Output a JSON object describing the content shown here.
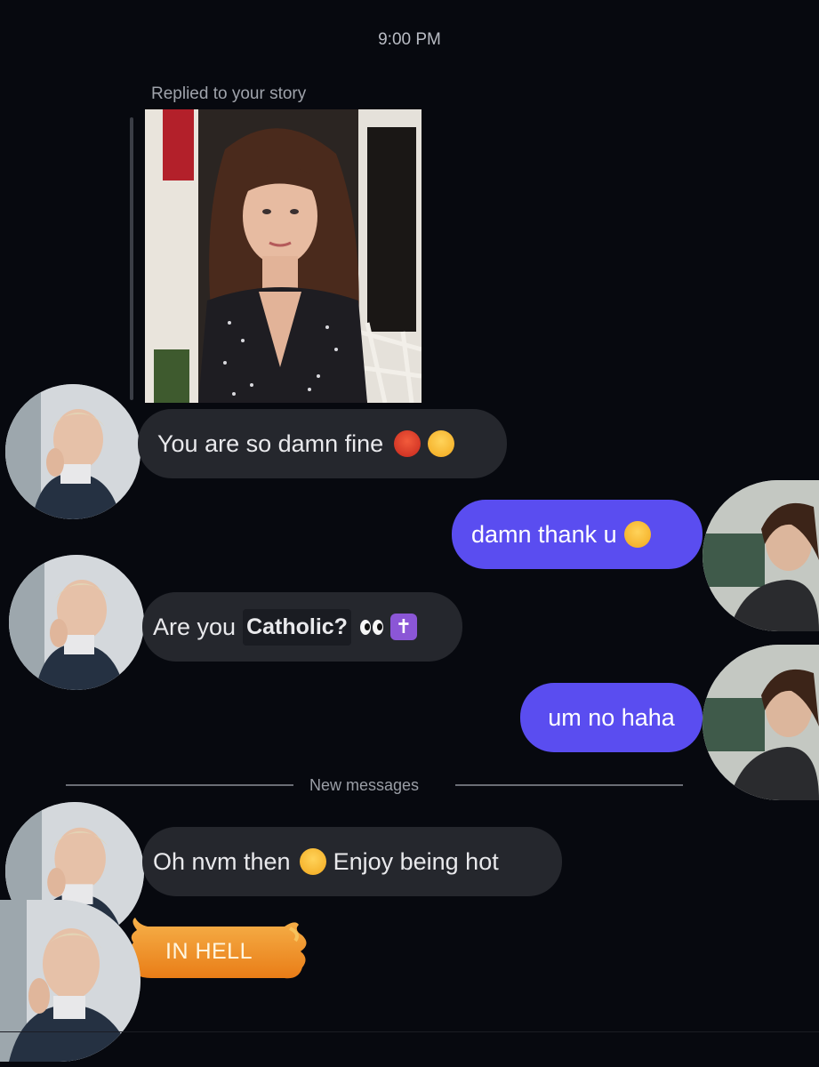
{
  "header": {
    "timestamp": "9:00 PM",
    "reply_label": "Replied to your story"
  },
  "messages": {
    "m1": {
      "text": "You are so damn fine",
      "emojis": [
        "hot-face-emoji",
        "exhausted-face-emoji"
      ]
    },
    "m2": {
      "text": "damn thank u",
      "emojis": [
        "crying-face-emoji"
      ]
    },
    "m3": {
      "text_a": "Are you",
      "text_b": "Catholic?",
      "emojis": [
        "eyes-emoji",
        "latin-cross-emoji"
      ]
    },
    "m4": {
      "text": "um no haha"
    },
    "divider": "New messages",
    "m5": {
      "text_a": "Oh nvm then",
      "text_b": "Enjoy being hot",
      "emojis": [
        "tears-of-joy-emoji"
      ]
    },
    "m6": {
      "text": "IN HELL",
      "effect": "flame-effect"
    }
  },
  "colors": {
    "background": "#07090f",
    "incoming_bubble": "#25272d",
    "outgoing_bubble": "#5a4df0",
    "flame": "#f0952a"
  }
}
